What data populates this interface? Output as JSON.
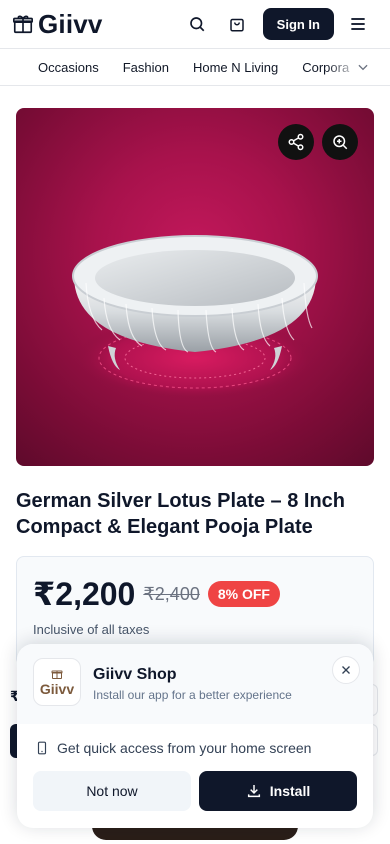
{
  "header": {
    "logo_text": "Giivv",
    "signin_label": "Sign In"
  },
  "nav": {
    "items": [
      "Occasions",
      "Fashion",
      "Home N Living",
      "Corpora"
    ]
  },
  "product": {
    "title": "German Silver Lotus Plate – 8 Inch Compact & Elegant Pooja Plate",
    "price": "₹2,200",
    "mrp": "₹2,400",
    "discount": "8% OFF",
    "tax_note": "Inclusive of all taxes"
  },
  "behind": {
    "currency_symbol": "₹"
  },
  "install_popup": {
    "app_name": "Giivv Shop",
    "subtitle": "Install our app for a better experience",
    "icon_text": "Giivv",
    "quick_access": "Get quick access from your home screen",
    "not_now": "Not now",
    "install": "Install"
  },
  "colors": {
    "primary": "#0f172a",
    "discount_badge": "#ef4444",
    "image_background": "#a8124c"
  },
  "icons": [
    "gift-logo-icon",
    "search-icon",
    "bag-icon",
    "menu-icon",
    "chevron-down-icon",
    "share-icon",
    "zoom-icon",
    "close-icon",
    "phone-icon",
    "download-icon"
  ]
}
